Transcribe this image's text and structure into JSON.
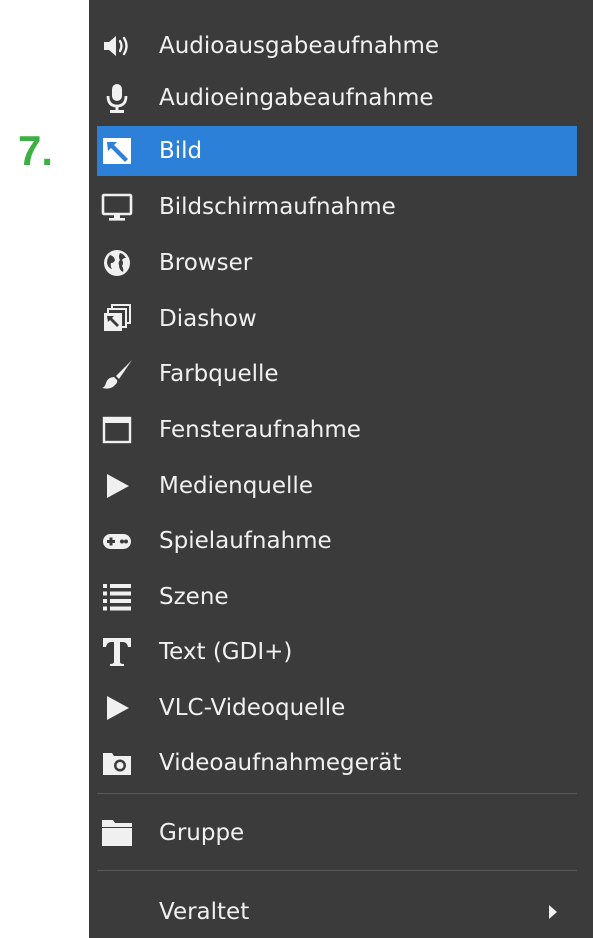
{
  "step_label": "7.",
  "colors": {
    "menu_background": "#3b3b3b",
    "selected_background": "#2d80d8",
    "step_label": "#3cb043"
  },
  "menu": {
    "items": [
      {
        "label": "Audioausgabeaufnahme",
        "icon": "speaker-icon"
      },
      {
        "label": "Audioeingabeaufnahme",
        "icon": "microphone-icon"
      },
      {
        "label": "Bild",
        "icon": "image-icon",
        "selected": true
      },
      {
        "label": "Bildschirmaufnahme",
        "icon": "monitor-icon"
      },
      {
        "label": "Browser",
        "icon": "globe-icon"
      },
      {
        "label": "Diashow",
        "icon": "slideshow-icon"
      },
      {
        "label": "Farbquelle",
        "icon": "paintbrush-icon"
      },
      {
        "label": "Fensteraufnahme",
        "icon": "window-icon"
      },
      {
        "label": "Medienquelle",
        "icon": "play-icon"
      },
      {
        "label": "Spielaufnahme",
        "icon": "gamepad-icon"
      },
      {
        "label": "Szene",
        "icon": "list-icon"
      },
      {
        "label": "Text (GDI+)",
        "icon": "text-icon"
      },
      {
        "label": "VLC-Videoquelle",
        "icon": "play-icon"
      },
      {
        "label": "Videoaufnahmegerät",
        "icon": "camera-icon"
      },
      {
        "label": "Gruppe",
        "icon": "folder-icon"
      },
      {
        "label": "Veraltet",
        "icon": "",
        "has_submenu": true
      }
    ]
  }
}
